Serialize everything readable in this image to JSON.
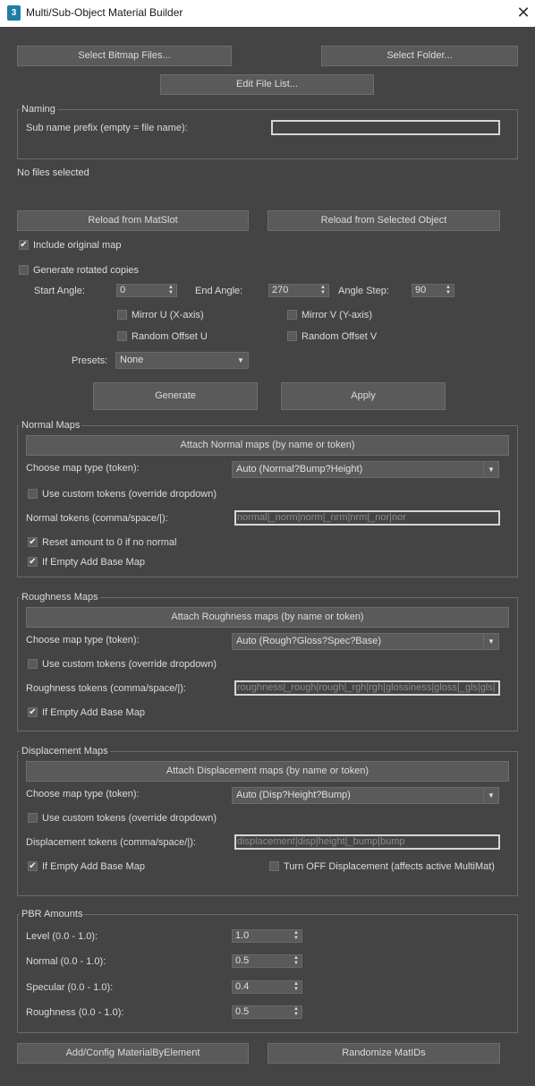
{
  "window": {
    "title": "Multi/Sub-Object Material Builder",
    "icon_text": "3"
  },
  "top": {
    "select_bitmaps": "Select Bitmap Files...",
    "select_folder": "Select Folder...",
    "edit_file_list": "Edit File List..."
  },
  "naming": {
    "title": "Naming",
    "prefix_label": "Sub name prefix (empty = file name):",
    "prefix_value": ""
  },
  "status": {
    "files": "No files selected"
  },
  "reload": {
    "from_matslot": "Reload from MatSlot",
    "from_selected": "Reload from Selected Object"
  },
  "options": {
    "include_original": "Include original map",
    "generate_rotated": "Generate rotated copies",
    "start_angle_label": "Start Angle:",
    "start_angle": "0",
    "end_angle_label": "End Angle:",
    "end_angle": "270",
    "angle_step_label": "Angle Step:",
    "angle_step": "90",
    "mirror_u": "Mirror U (X-axis)",
    "mirror_v": "Mirror V (Y-axis)",
    "random_u": "Random Offset U",
    "random_v": "Random Offset V",
    "presets_label": "Presets:",
    "presets_value": "None",
    "generate": "Generate",
    "apply": "Apply"
  },
  "normal": {
    "title": "Normal Maps",
    "attach": "Attach Normal maps (by name or token)",
    "type_label": "Choose map type (token):",
    "type_value": "Auto (Normal?Bump?Height)",
    "custom": "Use custom tokens (override dropdown)",
    "tokens_label": "Normal tokens (comma/space/|):",
    "tokens_value": "normal|_norm|norm|_nrm|nrm|_nor|nor",
    "reset": "Reset amount to 0 if no normal",
    "empty_base": "If Empty Add Base Map"
  },
  "roughness": {
    "title": "Roughness Maps",
    "attach": "Attach Roughness maps (by name or token)",
    "type_label": "Choose map type (token):",
    "type_value": "Auto (Rough?Gloss?Spec?Base)",
    "custom": "Use custom tokens (override dropdown)",
    "tokens_label": "Roughness tokens (comma/space/|):",
    "tokens_value": "roughness|_rough|rough|_rgh|rgh|glossiness|gloss|_gls|gls|",
    "empty_base": "If Empty Add Base Map"
  },
  "displacement": {
    "title": "Displacement Maps",
    "attach": "Attach Displacement maps (by name or token)",
    "type_label": "Choose map type (token):",
    "type_value": "Auto (Disp?Height?Bump)",
    "custom": "Use custom tokens (override dropdown)",
    "tokens_label": "Displacement tokens (comma/space/|):",
    "tokens_value": "displacement|disp|height|_bump|bump",
    "empty_base": "If Empty Add Base Map",
    "turn_off": "Turn OFF Displacement (affects active MultiMat)"
  },
  "pbr": {
    "title": "PBR Amounts",
    "level_label": "Level (0.0 - 1.0):",
    "level": "1.0",
    "normal_label": "Normal (0.0 - 1.0):",
    "normal": "0.5",
    "specular_label": "Specular (0.0 - 1.0):",
    "specular": "0.4",
    "roughness_label": "Roughness (0.0 - 1.0):",
    "roughness": "0.5"
  },
  "bottom": {
    "add_config": "Add/Config MaterialByElement",
    "randomize": "Randomize MatIDs"
  }
}
